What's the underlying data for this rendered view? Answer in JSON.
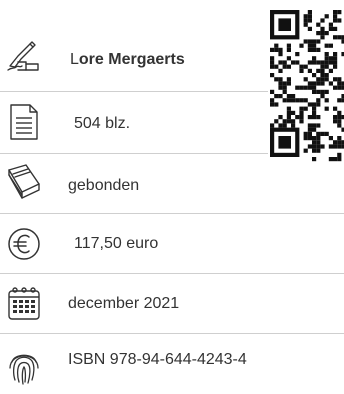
{
  "author": {
    "first_letter": "L",
    "name_rest": "ore Mergaerts",
    "icon": "writing-hand-icon"
  },
  "pages": {
    "label": "504 blz.",
    "icon": "document-icon"
  },
  "binding": {
    "label": "gebonden",
    "icon": "book-icon"
  },
  "price": {
    "label": "117,50 euro",
    "icon": "euro-icon"
  },
  "date": {
    "label": "december 2021",
    "icon": "calendar-icon"
  },
  "isbn": {
    "label": "ISBN 978-94-644-4243-4",
    "icon": "fingerprint-icon"
  },
  "qr_code": {
    "icon": "qr-code-icon"
  },
  "colors": {
    "text": "#333333",
    "divider": "#cfcfcf",
    "qr": "#111111"
  }
}
